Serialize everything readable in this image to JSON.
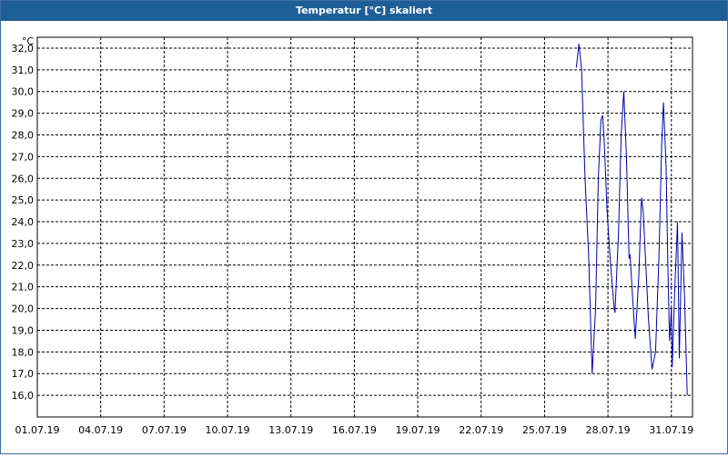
{
  "window": {
    "title": "Temperatur [°C] skaliert"
  },
  "chart_data": {
    "type": "line",
    "title": "Temperatur [°C] skaliert",
    "ylabel": "°C",
    "xlabel": "",
    "grid": true,
    "x_ticks": [
      "01.07.19",
      "04.07.19",
      "07.07.19",
      "10.07.19",
      "13.07.19",
      "16.07.19",
      "19.07.19",
      "22.07.19",
      "25.07.19",
      "28.07.19",
      "31.07.19"
    ],
    "y_ticks": [
      "16,0",
      "17,0",
      "18,0",
      "19,0",
      "20,0",
      "21,0",
      "22,0",
      "23,0",
      "24,0",
      "25,0",
      "26,0",
      "27,0",
      "28,0",
      "29,0",
      "30,0",
      "31,0",
      "32,0"
    ],
    "ylim": [
      15.0,
      32.5
    ],
    "xlim": [
      "01.07.19",
      "01.08.19"
    ],
    "series": [
      {
        "color": "#0000aa",
        "points": [
          [
            "26.07.19 12:00",
            31.1
          ],
          [
            "26.07.19 15:00",
            32.2
          ],
          [
            "26.07.19 18:00",
            31.0
          ],
          [
            "26.07.19 22:00",
            26.0
          ],
          [
            "27.07.19 02:00",
            22.5
          ],
          [
            "27.07.19 06:00",
            17.0
          ],
          [
            "27.07.19 10:00",
            20.0
          ],
          [
            "27.07.19 13:00",
            26.0
          ],
          [
            "27.07.19 16:00",
            28.7
          ],
          [
            "27.07.19 18:00",
            28.9
          ],
          [
            "27.07.19 20:00",
            27.5
          ],
          [
            "27.07.19 23:00",
            24.5
          ],
          [
            "28.07.19 03:00",
            22.0
          ],
          [
            "28.07.19 07:00",
            20.0
          ],
          [
            "28.07.19 08:00",
            19.8
          ],
          [
            "28.07.19 12:00",
            23.5
          ],
          [
            "28.07.19 15:00",
            28.0
          ],
          [
            "28.07.19 18:00",
            30.0
          ],
          [
            "28.07.19 21:00",
            27.0
          ],
          [
            "29.07.19 00:00",
            22.3
          ],
          [
            "29.07.19 01:00",
            22.5
          ],
          [
            "29.07.19 04:00",
            20.5
          ],
          [
            "29.07.19 07:00",
            18.6
          ],
          [
            "29.07.19 11:00",
            21.5
          ],
          [
            "29.07.19 14:00",
            25.1
          ],
          [
            "29.07.19 16:00",
            24.5
          ],
          [
            "29.07.19 19:00",
            22.0
          ],
          [
            "29.07.19 22:00",
            19.5
          ],
          [
            "30.07.19 02:00",
            17.2
          ],
          [
            "30.07.19 06:00",
            18.0
          ],
          [
            "30.07.19 10:00",
            22.5
          ],
          [
            "30.07.19 13:00",
            27.5
          ],
          [
            "30.07.19 15:00",
            29.5
          ],
          [
            "30.07.19 18:00",
            26.5
          ],
          [
            "30.07.19 20:00",
            22.0
          ],
          [
            "30.07.19 22:00",
            18.5
          ],
          [
            "31.07.19 00:00",
            20.0
          ],
          [
            "31.07.19 01:00",
            17.3
          ],
          [
            "31.07.19 04:00",
            21.0
          ],
          [
            "31.07.19 07:00",
            24.0
          ],
          [
            "31.07.19 09:00",
            17.7
          ],
          [
            "31.07.19 12:00",
            23.5
          ],
          [
            "31.07.19 15:00",
            20.5
          ],
          [
            "31.07.19 18:00",
            16.0
          ]
        ]
      }
    ]
  }
}
